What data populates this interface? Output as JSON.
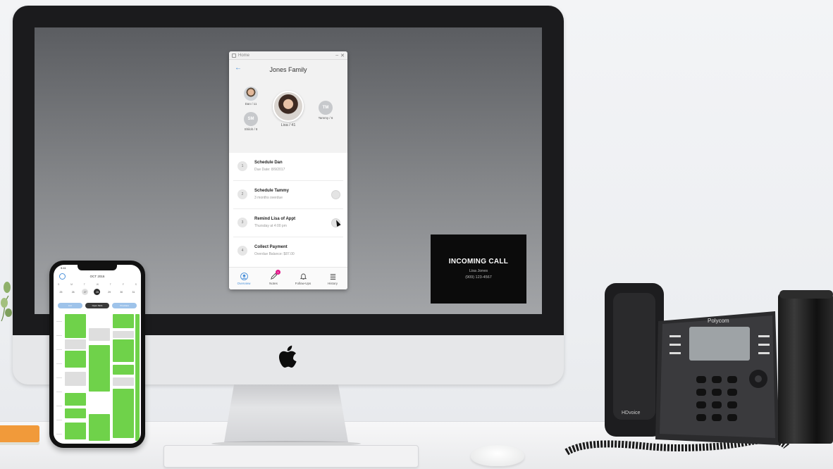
{
  "app": {
    "window_title": "Home",
    "family_title": "Jones Family",
    "members": [
      {
        "label": "Dan / 11",
        "initials": ""
      },
      {
        "label": "Shiloh / 8",
        "initials": "SM"
      },
      {
        "label": "Lisa / 41",
        "initials": ""
      },
      {
        "label": "Tammy / 6",
        "initials": "TM"
      }
    ],
    "tasks": [
      {
        "num": "1",
        "title": "Schedule Dan",
        "subtitle": "Due Date: 8/9/2017"
      },
      {
        "num": "2",
        "title": "Schedule Tammy",
        "subtitle": "3 months overdue"
      },
      {
        "num": "3",
        "title": "Remind Lisa of Appt",
        "subtitle": "Thursday at 4:00 pm"
      },
      {
        "num": "4",
        "title": "Collect Payment",
        "subtitle": "Overdue Balance: $87.00"
      }
    ],
    "nav": [
      {
        "label": "Overview",
        "icon": "user-icon"
      },
      {
        "label": "Notes",
        "icon": "pencil-icon",
        "badge": "1"
      },
      {
        "label": "Follow-Ups",
        "icon": "bell-icon"
      },
      {
        "label": "History",
        "icon": "list-icon"
      }
    ],
    "accent_color": "#4a90d9",
    "badge_color": "#e2188a"
  },
  "call": {
    "title": "INCOMING CALL",
    "name": "Lisa Jones",
    "number": "(909) 123-4567"
  },
  "phone": {
    "status_time": "9:41",
    "month": "OCT 2016",
    "days": [
      "S",
      "M",
      "T",
      "W",
      "T",
      "F",
      "S"
    ],
    "dates": [
      "25",
      "26",
      "27",
      "28",
      "29",
      "30",
      "31"
    ],
    "tabs": [
      "List",
      "Open Slots",
      "Providers"
    ],
    "block_color": "#6fd24a"
  },
  "deskphone": {
    "brand": "Polycom",
    "handset_label": "HDvoice"
  }
}
